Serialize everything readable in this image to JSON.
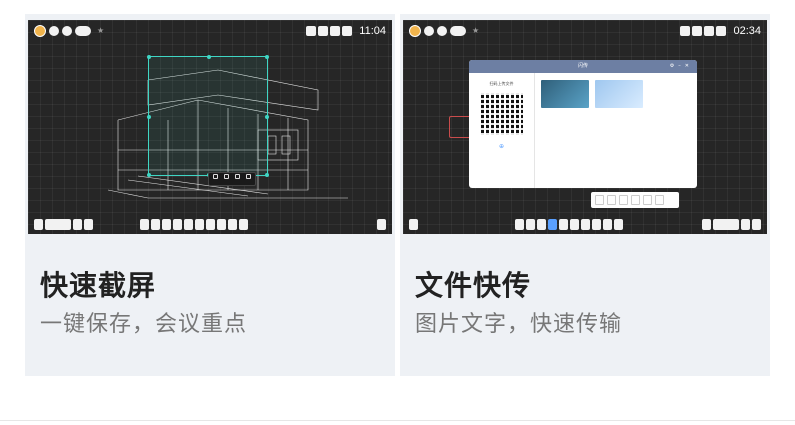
{
  "cards": [
    {
      "title": "快速截屏",
      "subtitle": "一键保存，会议重点",
      "screen": {
        "clock": "11:04",
        "shot_tools": [
          "",
          "",
          "",
          "",
          ""
        ]
      }
    },
    {
      "title": "文件快传",
      "subtitle": "图片文字，快速传输",
      "screen": {
        "clock": "02:34",
        "window_title": "闪传",
        "qr_label": "扫码上传文件",
        "qr_note": "",
        "thumb_names": [
          "",
          ""
        ],
        "save_label": ""
      }
    }
  ],
  "colors": {
    "card_bg": "#eef1f5",
    "screen_bg": "#262626",
    "selection": "#3fd6c4",
    "title_text": "#222222",
    "subtitle_text": "#777777"
  }
}
